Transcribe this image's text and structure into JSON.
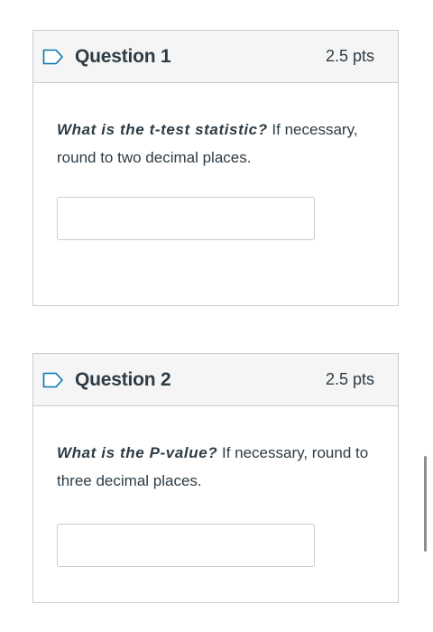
{
  "questions": [
    {
      "title": "Question 1",
      "points": "2.5 pts",
      "prompt_emphasis": "What is the t-test statistic?",
      "prompt_rest": " If necessary, round to two decimal places.",
      "answer_value": ""
    },
    {
      "title": "Question 2",
      "points": "2.5 pts",
      "prompt_emphasis": "What is the P-value?",
      "prompt_rest": " If necessary, round to three decimal places.",
      "answer_value": ""
    }
  ],
  "icons": {
    "flag": "bookmark-flag-icon"
  },
  "colors": {
    "text": "#2d3b45",
    "header_bg": "#f5f5f5",
    "border": "#c7cdd1",
    "flag_accent": "#0374b5"
  }
}
